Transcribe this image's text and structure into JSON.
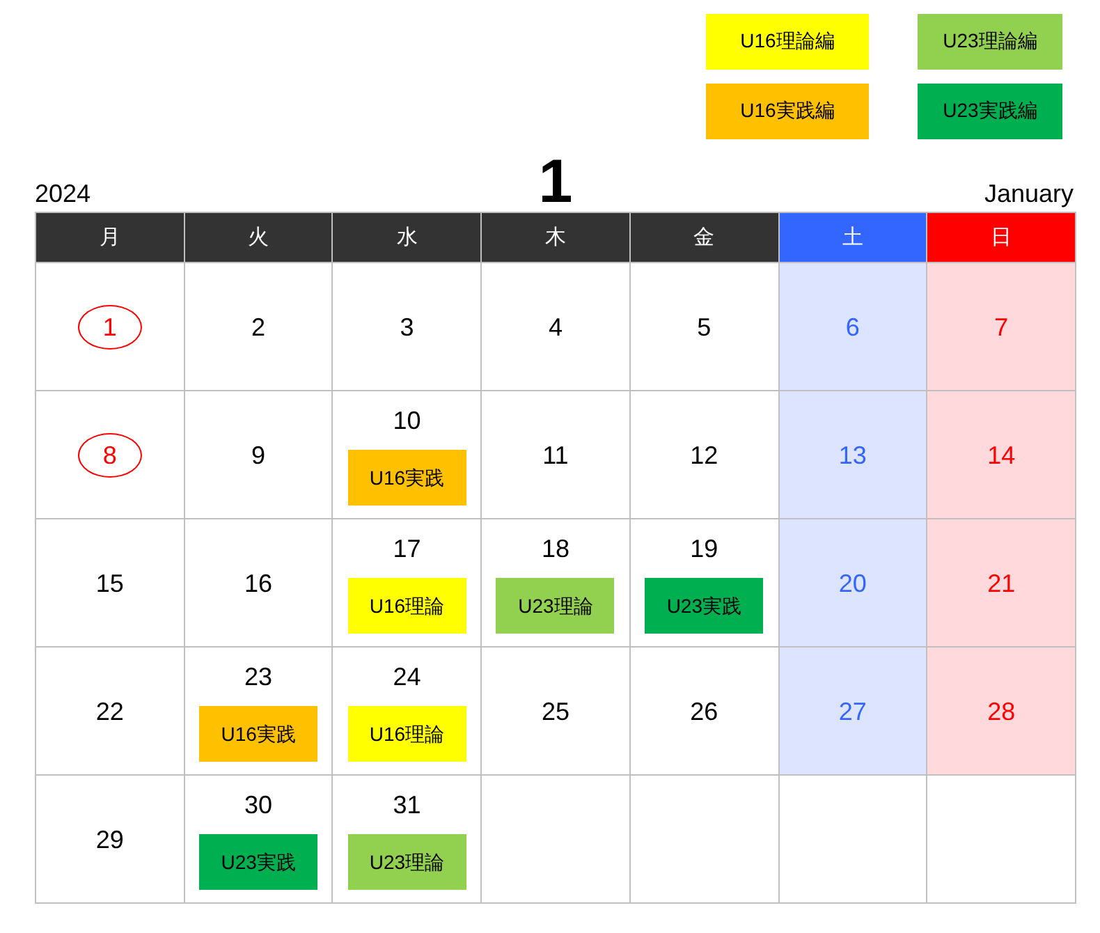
{
  "legend": [
    {
      "label": "U16理論編",
      "color": "#ffff00"
    },
    {
      "label": "U23理論編",
      "color": "#92d050"
    },
    {
      "label": "U16実践編",
      "color": "#ffc000"
    },
    {
      "label": "U23実践編",
      "color": "#00b050"
    }
  ],
  "year": "2024",
  "month_number": "1",
  "month_name": "January",
  "weekdays": [
    {
      "label": "月",
      "kind": "weekday"
    },
    {
      "label": "火",
      "kind": "weekday"
    },
    {
      "label": "水",
      "kind": "weekday"
    },
    {
      "label": "木",
      "kind": "weekday"
    },
    {
      "label": "金",
      "kind": "weekday"
    },
    {
      "label": "土",
      "kind": "saturday"
    },
    {
      "label": "日",
      "kind": "sunday"
    }
  ],
  "weeks": [
    [
      {
        "day": "1",
        "holiday": true
      },
      {
        "day": "2",
        "holiday": false
      },
      {
        "day": "3",
        "holiday": false
      },
      {
        "day": "4",
        "holiday": false
      },
      {
        "day": "5",
        "holiday": false
      },
      {
        "day": "6",
        "holiday": false
      },
      {
        "day": "7",
        "holiday": false
      }
    ],
    [
      {
        "day": "8",
        "holiday": true
      },
      {
        "day": "9",
        "holiday": false
      },
      {
        "day": "10",
        "holiday": false,
        "event": {
          "label": "U16実践",
          "color": "#ffc000"
        }
      },
      {
        "day": "11",
        "holiday": false
      },
      {
        "day": "12",
        "holiday": false
      },
      {
        "day": "13",
        "holiday": false
      },
      {
        "day": "14",
        "holiday": false
      }
    ],
    [
      {
        "day": "15",
        "holiday": false
      },
      {
        "day": "16",
        "holiday": false
      },
      {
        "day": "17",
        "holiday": false,
        "event": {
          "label": "U16理論",
          "color": "#ffff00"
        }
      },
      {
        "day": "18",
        "holiday": false,
        "event": {
          "label": "U23理論",
          "color": "#92d050"
        }
      },
      {
        "day": "19",
        "holiday": false,
        "event": {
          "label": "U23実践",
          "color": "#00b050"
        }
      },
      {
        "day": "20",
        "holiday": false
      },
      {
        "day": "21",
        "holiday": false
      }
    ],
    [
      {
        "day": "22",
        "holiday": false
      },
      {
        "day": "23",
        "holiday": false,
        "event": {
          "label": "U16実践",
          "color": "#ffc000"
        }
      },
      {
        "day": "24",
        "holiday": false,
        "event": {
          "label": "U16理論",
          "color": "#ffff00"
        }
      },
      {
        "day": "25",
        "holiday": false
      },
      {
        "day": "26",
        "holiday": false
      },
      {
        "day": "27",
        "holiday": false
      },
      {
        "day": "28",
        "holiday": false
      }
    ],
    [
      {
        "day": "29",
        "holiday": false
      },
      {
        "day": "30",
        "holiday": false,
        "event": {
          "label": "U23実践",
          "color": "#00b050"
        }
      },
      {
        "day": "31",
        "holiday": false,
        "event": {
          "label": "U23理論",
          "color": "#92d050"
        }
      }
    ]
  ]
}
